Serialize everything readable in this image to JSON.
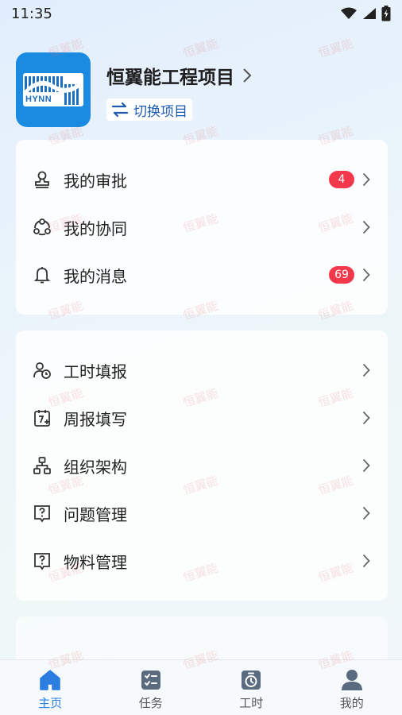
{
  "status_bar": {
    "time": "11:35"
  },
  "header": {
    "logo_text": "HYNN",
    "project_title": "恒翼能工程项目",
    "switch_label": "切换项目"
  },
  "card1": {
    "items": [
      {
        "label": "我的审批",
        "badge": "4",
        "icon": "stamp-icon"
      },
      {
        "label": "我的协同",
        "badge": "",
        "icon": "collaboration-icon"
      },
      {
        "label": "我的消息",
        "badge": "69",
        "icon": "bell-icon"
      }
    ]
  },
  "card2": {
    "items": [
      {
        "label": "工时填报",
        "icon": "timesheet-icon"
      },
      {
        "label": "周报填写",
        "icon": "weekly-report-icon"
      },
      {
        "label": "组织架构",
        "icon": "org-chart-icon"
      },
      {
        "label": "问题管理",
        "icon": "question-icon"
      },
      {
        "label": "物料管理",
        "icon": "question-icon"
      }
    ]
  },
  "bottom_nav": {
    "tabs": [
      {
        "label": "主页",
        "icon": "home-icon",
        "active": true
      },
      {
        "label": "任务",
        "icon": "task-icon",
        "active": false
      },
      {
        "label": "工时",
        "icon": "timer-icon",
        "active": false
      },
      {
        "label": "我的",
        "icon": "user-icon",
        "active": false
      }
    ]
  },
  "watermark": {
    "text": "恒翼能"
  },
  "colors": {
    "accent": "#2b7de0",
    "badge": "#f2384a",
    "logo_bg": "#1a8be0"
  }
}
